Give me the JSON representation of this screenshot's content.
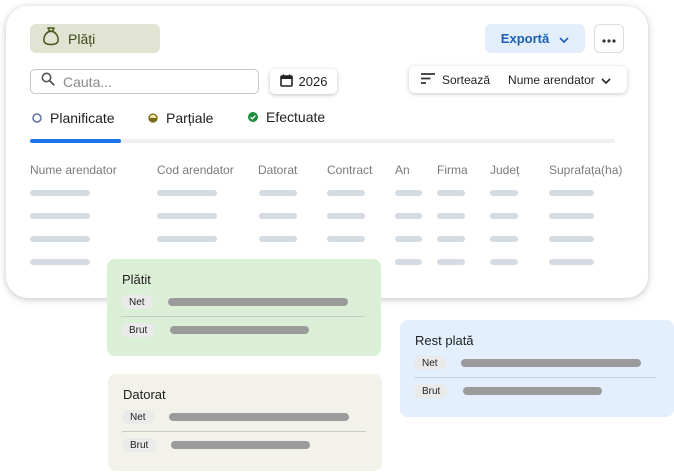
{
  "header": {
    "title": "Plăți",
    "export_label": "Exportă",
    "more_icon": "more-vert-icon"
  },
  "search": {
    "placeholder": "Cauta..."
  },
  "year": {
    "label": "2026"
  },
  "sort": {
    "label": "Sortează",
    "value": "Nume arendator"
  },
  "tabs": [
    {
      "label": "Planificate",
      "status": "planned",
      "color": "#5f6fa0",
      "selected": true
    },
    {
      "label": "Parțiale",
      "status": "partial",
      "color": "#8a7a1e",
      "selected": false
    },
    {
      "label": "Efectuate",
      "status": "done",
      "color": "#1e8e3e",
      "selected": false
    }
  ],
  "table": {
    "columns": [
      "Nume arendator",
      "Cod arendator",
      "Datorat",
      "Contract",
      "An",
      "Firma",
      "Județ",
      "Suprafața(ha)"
    ]
  },
  "summary": {
    "paid": {
      "title": "Plătit",
      "net_label": "Net",
      "gross_label": "Brut",
      "bg": "#dbeed6"
    },
    "owed": {
      "title": "Datorat",
      "net_label": "Net",
      "gross_label": "Brut",
      "bg": "#f2f2ea"
    },
    "remaining": {
      "title": "Rest plată",
      "net_label": "Net",
      "gross_label": "Brut",
      "bg": "#e3effc"
    }
  },
  "colors": {
    "accent": "#1a73e8",
    "chip_bg": "#e1e4d3",
    "export_bg": "#e3eefb",
    "export_text": "#1a5fb4"
  }
}
